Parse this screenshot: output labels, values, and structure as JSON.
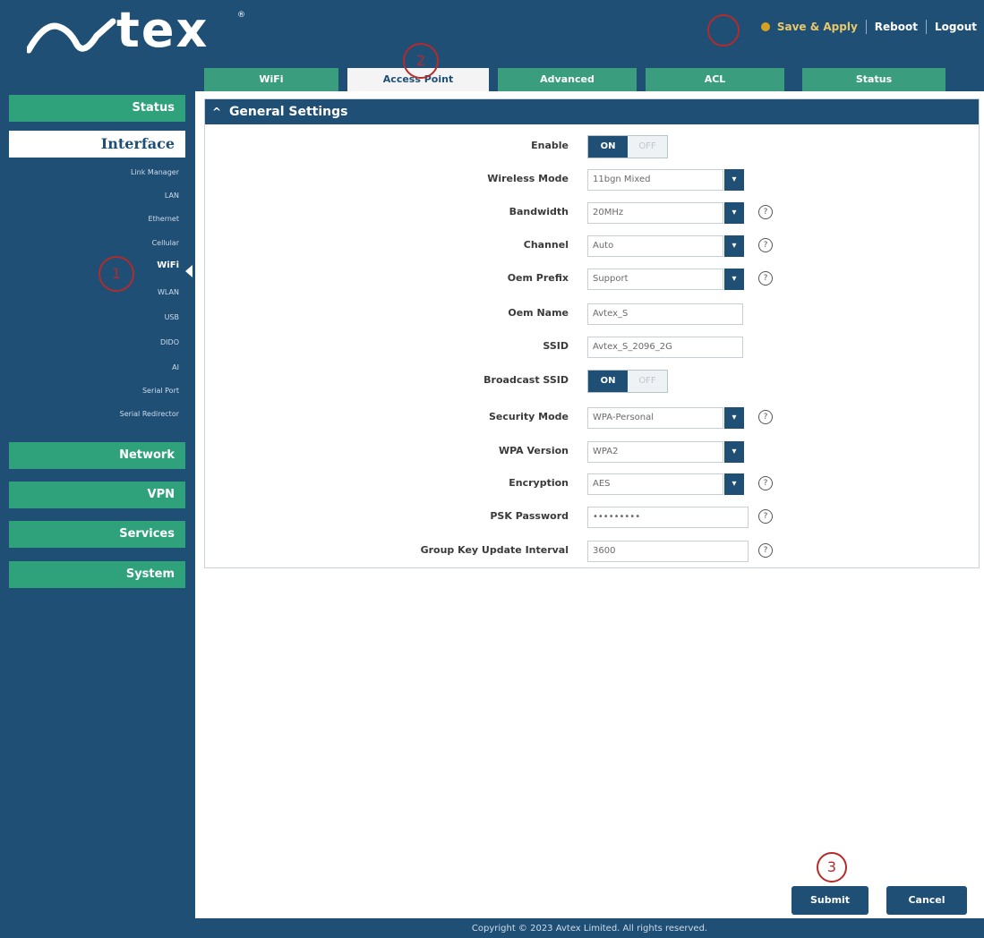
{
  "brand": {
    "logo_text": "tex",
    "logo_reg": "®"
  },
  "top_actions": {
    "save_apply": "Save & Apply",
    "reboot": "Reboot",
    "logout": "Logout"
  },
  "tabs": [
    {
      "label": "WiFi"
    },
    {
      "label": "Access Point",
      "active": true
    },
    {
      "label": "Advanced"
    },
    {
      "label": "ACL"
    },
    {
      "label": "Status"
    }
  ],
  "sidebar": {
    "status": "Status",
    "interface": "Interface",
    "subitems": [
      "Link Manager",
      "LAN",
      "Ethernet",
      "Cellular",
      "WiFi",
      "WLAN",
      "USB",
      "DIDO",
      "AI",
      "Serial Port",
      "Serial Redirector"
    ],
    "selected_subitem": "WiFi",
    "network": "Network",
    "vpn": "VPN",
    "services": "Services",
    "system": "System"
  },
  "panel": {
    "title": "General Settings",
    "fields": {
      "enable": {
        "label": "Enable",
        "on": "ON",
        "off": "OFF"
      },
      "wireless_mode": {
        "label": "Wireless Mode",
        "value": "11bgn Mixed"
      },
      "bandwidth": {
        "label": "Bandwidth",
        "value": "20MHz"
      },
      "channel": {
        "label": "Channel",
        "value": "Auto"
      },
      "oem_prefix": {
        "label": "Oem Prefix",
        "value": "Support"
      },
      "oem_name": {
        "label": "Oem Name",
        "value": "Avtex_S"
      },
      "ssid": {
        "label": "SSID",
        "value": "Avtex_S_2096_2G"
      },
      "broadcast_ssid": {
        "label": "Broadcast SSID",
        "on": "ON",
        "off": "OFF"
      },
      "security_mode": {
        "label": "Security Mode",
        "value": "WPA-Personal"
      },
      "wpa_version": {
        "label": "WPA Version",
        "value": "WPA2"
      },
      "encryption": {
        "label": "Encryption",
        "value": "AES"
      },
      "psk_password": {
        "label": "PSK Password",
        "value": "•••••••••"
      },
      "group_key_interval": {
        "label": "Group Key Update Interval",
        "value": "3600"
      }
    }
  },
  "buttons": {
    "submit": "Submit",
    "cancel": "Cancel"
  },
  "annotations": {
    "one": "1",
    "two": "2",
    "three": "3"
  },
  "footer": {
    "text": "Copyright © 2023 Avtex Limited. All rights reserved."
  },
  "colors": {
    "navy": "#1f4f75",
    "green": "#2fa27c",
    "annotation_red": "#b52a2a"
  }
}
